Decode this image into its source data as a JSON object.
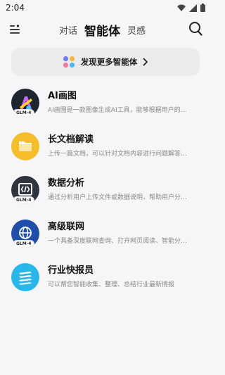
{
  "status": {
    "time": "2:04"
  },
  "header": {
    "tabs": [
      {
        "label": "对话"
      },
      {
        "label": "智能体"
      },
      {
        "label": "灵感"
      }
    ]
  },
  "discover": {
    "label": "发现更多智能体"
  },
  "agents": [
    {
      "title": "AI画图",
      "desc": "AI画图是一款图像生成AI工具，能够根据用户的…",
      "badge": "GLM-4"
    },
    {
      "title": "长文档解读",
      "desc": "上传一篇文档，可以针对文档内容进行问题解答…"
    },
    {
      "title": "数据分析",
      "desc": "通过分析用户上传文件或数据说明，帮助用户分…",
      "badge": "GLM-4"
    },
    {
      "title": "高级联网",
      "desc": "一个具备深度联网查询、打开网页阅读、智能分…",
      "badge": "GLM-4"
    },
    {
      "title": "行业快报员",
      "desc": "可以帮您智能收集、整理、总结行业最新情报"
    }
  ],
  "colors": {
    "background": "#f6f6f8",
    "ai_drawing": "#1f2530",
    "long_doc": "#f5bd2a",
    "data_analysis": "#2e3440",
    "web_search": "#1f4fa8",
    "industry_news": "#29b6e8"
  }
}
